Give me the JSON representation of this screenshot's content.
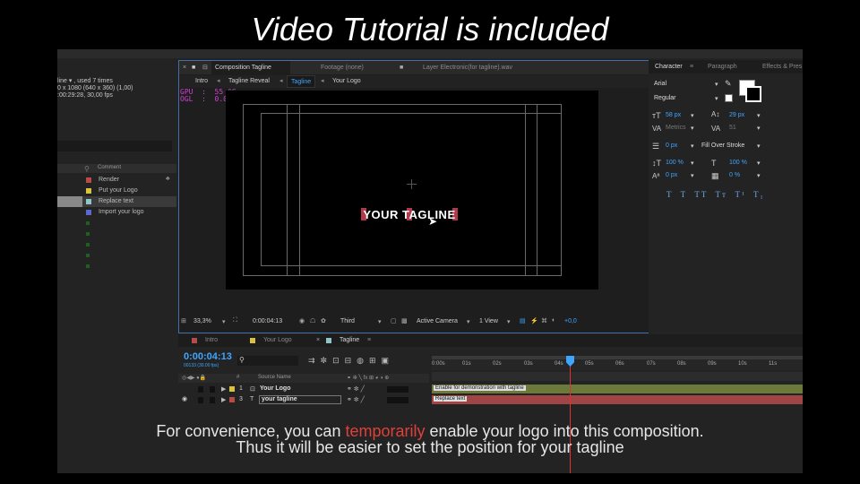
{
  "headline": "Video Tutorial is included",
  "project_panel": {
    "info": [
      "line ▾ , used 7 times",
      "0 x 1080  (640 x 360) (1,00)",
      ":00:29:28, 30,00 fps"
    ],
    "comment_header": "Comment",
    "rows": [
      {
        "label": "Render",
        "color": "#b84a4a"
      },
      {
        "label": "Put your Logo",
        "color": "#d8c23e"
      },
      {
        "label": "Replace text",
        "color": "#8fc7c7"
      },
      {
        "label": "Import your logo",
        "color": "#5b6ac9"
      }
    ]
  },
  "viewer": {
    "tabs": [
      "Composition Tagline",
      "Footage (none)",
      "Layer Electronic(for tagline).wav"
    ],
    "crumbs": [
      "Intro",
      "Tagline Reveal",
      "Tagline",
      "Your Logo"
    ],
    "gpu_text": "GPU  :  55 °C\nOGL  :  0.0 FPS",
    "canvas_text": "YOUR TAGLINE",
    "bottom": {
      "zoom": "33,3%",
      "time": "0:00:04:13",
      "resolution": "Third",
      "camera": "Active Camera",
      "views": "1 View",
      "exposure": "+0,0"
    }
  },
  "character": {
    "tabs": [
      "Character",
      "Paragraph",
      "Effects & Pres"
    ],
    "font": "Arial",
    "style": "Regular",
    "size": "58 px",
    "leading": "29 px",
    "kerning": "Metrics",
    "tracking": "51",
    "stroke_width": "0 px",
    "stroke_mode": "Fill Over Stroke",
    "vscale": "100 %",
    "hscale": "100 %",
    "baseline": "0 px",
    "tsume": "0 %",
    "styles": "T  T  TT  Tт  T¹  T₁"
  },
  "timeline": {
    "tabs": [
      "Intro",
      "Your Logo",
      "Tagline"
    ],
    "tab_colors": [
      "#b84a4a",
      "#d8c23e",
      "#8fc7c7"
    ],
    "timecode": "0:00:04:13",
    "subtime": "00133 (30.00 fps)",
    "source_header": "Source Name",
    "layers": [
      {
        "num": "1",
        "name": "Your Logo",
        "color": "#d8c23e"
      },
      {
        "num": "3",
        "name": "your tagline",
        "color": "#b84a4a"
      }
    ],
    "ruler_ticks": [
      "0:00s",
      "01s",
      "02s",
      "03s",
      "04s",
      "05s",
      "06s",
      "07s",
      "08s",
      "09s",
      "10s",
      "11s"
    ],
    "bar_labels": [
      "Enable for demonstration with tagline",
      "Replace text"
    ]
  },
  "caption": {
    "line1_pre": "For convenience, you can ",
    "line1_hl": "temporarily",
    "line1_post": " enable your logo into this composition.",
    "line2": "Thus it will be easier to set the position for your tagline"
  }
}
